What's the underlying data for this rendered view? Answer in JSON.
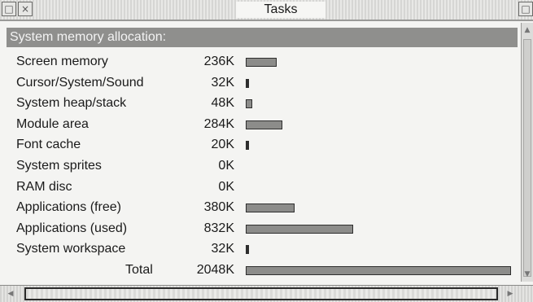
{
  "window": {
    "title": "Tasks",
    "back_icon": "back-icon",
    "close_icon": "close-icon",
    "toggle_icon": "toggle-size-icon"
  },
  "header": {
    "text": "System memory allocation:"
  },
  "rows": [
    {
      "label": "Screen memory",
      "value": "236K",
      "kb": 236
    },
    {
      "label": "Cursor/System/Sound",
      "value": "32K",
      "kb": 32
    },
    {
      "label": "System heap/stack",
      "value": "48K",
      "kb": 48
    },
    {
      "label": "Module area",
      "value": "284K",
      "kb": 284
    },
    {
      "label": "Font cache",
      "value": "20K",
      "kb": 20
    },
    {
      "label": "System sprites",
      "value": "0K",
      "kb": 0
    },
    {
      "label": "RAM disc",
      "value": "0K",
      "kb": 0
    },
    {
      "label": "Applications (free)",
      "value": "380K",
      "kb": 380
    },
    {
      "label": "Applications (used)",
      "value": "832K",
      "kb": 832
    },
    {
      "label": "System workspace",
      "value": "32K",
      "kb": 32
    }
  ],
  "total": {
    "label": "Total",
    "value": "2048K",
    "kb": 2048
  },
  "colors": {
    "bar_fill": "#8c8c8a",
    "header_bg": "#8f8f8d"
  }
}
